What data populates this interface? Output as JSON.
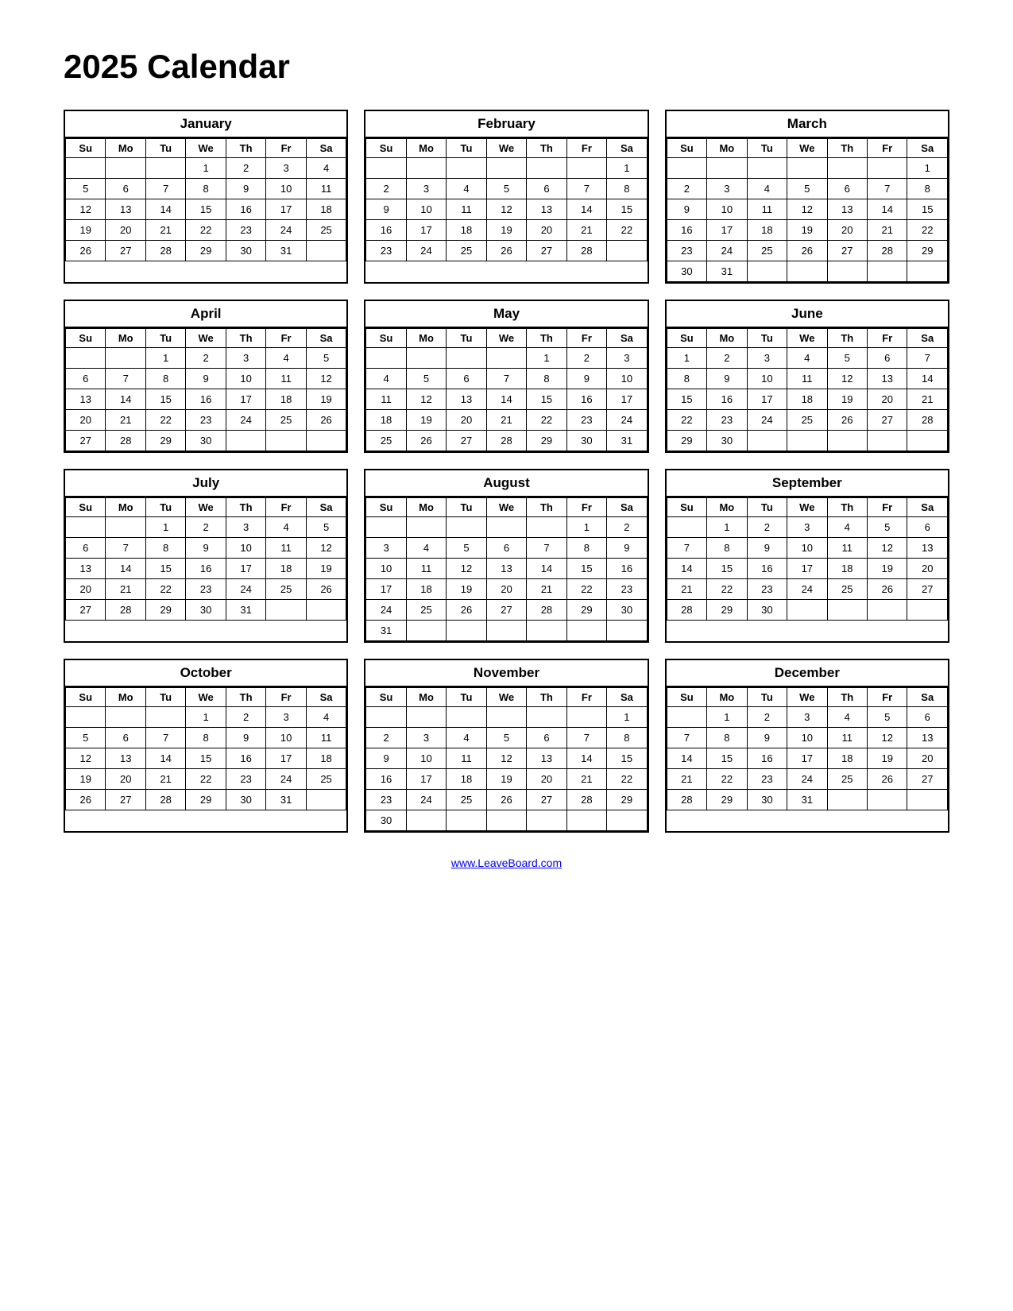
{
  "title": "2025 Calendar",
  "footer": "www.LeaveBoard.com",
  "days_header": [
    "Su",
    "Mo",
    "Tu",
    "We",
    "Th",
    "Fr",
    "Sa"
  ],
  "months": [
    {
      "name": "January",
      "weeks": [
        [
          "",
          "",
          "",
          "1",
          "2",
          "3",
          "4"
        ],
        [
          "5",
          "6",
          "7",
          "8",
          "9",
          "10",
          "11"
        ],
        [
          "12",
          "13",
          "14",
          "15",
          "16",
          "17",
          "18"
        ],
        [
          "19",
          "20",
          "21",
          "22",
          "23",
          "24",
          "25"
        ],
        [
          "26",
          "27",
          "28",
          "29",
          "30",
          "31",
          ""
        ]
      ]
    },
    {
      "name": "February",
      "weeks": [
        [
          "",
          "",
          "",
          "",
          "",
          "",
          "1"
        ],
        [
          "2",
          "3",
          "4",
          "5",
          "6",
          "7",
          "8"
        ],
        [
          "9",
          "10",
          "11",
          "12",
          "13",
          "14",
          "15"
        ],
        [
          "16",
          "17",
          "18",
          "19",
          "20",
          "21",
          "22"
        ],
        [
          "23",
          "24",
          "25",
          "26",
          "27",
          "28",
          ""
        ]
      ]
    },
    {
      "name": "March",
      "weeks": [
        [
          "",
          "",
          "",
          "",
          "",
          "",
          "1"
        ],
        [
          "2",
          "3",
          "4",
          "5",
          "6",
          "7",
          "8"
        ],
        [
          "9",
          "10",
          "11",
          "12",
          "13",
          "14",
          "15"
        ],
        [
          "16",
          "17",
          "18",
          "19",
          "20",
          "21",
          "22"
        ],
        [
          "23",
          "24",
          "25",
          "26",
          "27",
          "28",
          "29"
        ],
        [
          "30",
          "31",
          "",
          "",
          "",
          "",
          ""
        ]
      ]
    },
    {
      "name": "April",
      "weeks": [
        [
          "",
          "",
          "1",
          "2",
          "3",
          "4",
          "5"
        ],
        [
          "6",
          "7",
          "8",
          "9",
          "10",
          "11",
          "12"
        ],
        [
          "13",
          "14",
          "15",
          "16",
          "17",
          "18",
          "19"
        ],
        [
          "20",
          "21",
          "22",
          "23",
          "24",
          "25",
          "26"
        ],
        [
          "27",
          "28",
          "29",
          "30",
          "",
          "",
          ""
        ]
      ]
    },
    {
      "name": "May",
      "weeks": [
        [
          "",
          "",
          "",
          "",
          "1",
          "2",
          "3"
        ],
        [
          "4",
          "5",
          "6",
          "7",
          "8",
          "9",
          "10"
        ],
        [
          "11",
          "12",
          "13",
          "14",
          "15",
          "16",
          "17"
        ],
        [
          "18",
          "19",
          "20",
          "21",
          "22",
          "23",
          "24"
        ],
        [
          "25",
          "26",
          "27",
          "28",
          "29",
          "30",
          "31"
        ]
      ]
    },
    {
      "name": "June",
      "weeks": [
        [
          "1",
          "2",
          "3",
          "4",
          "5",
          "6",
          "7"
        ],
        [
          "8",
          "9",
          "10",
          "11",
          "12",
          "13",
          "14"
        ],
        [
          "15",
          "16",
          "17",
          "18",
          "19",
          "20",
          "21"
        ],
        [
          "22",
          "23",
          "24",
          "25",
          "26",
          "27",
          "28"
        ],
        [
          "29",
          "30",
          "",
          "",
          "",
          "",
          ""
        ]
      ]
    },
    {
      "name": "July",
      "weeks": [
        [
          "",
          "",
          "1",
          "2",
          "3",
          "4",
          "5"
        ],
        [
          "6",
          "7",
          "8",
          "9",
          "10",
          "11",
          "12"
        ],
        [
          "13",
          "14",
          "15",
          "16",
          "17",
          "18",
          "19"
        ],
        [
          "20",
          "21",
          "22",
          "23",
          "24",
          "25",
          "26"
        ],
        [
          "27",
          "28",
          "29",
          "30",
          "31",
          "",
          ""
        ]
      ]
    },
    {
      "name": "August",
      "weeks": [
        [
          "",
          "",
          "",
          "",
          "",
          "1",
          "2"
        ],
        [
          "3",
          "4",
          "5",
          "6",
          "7",
          "8",
          "9"
        ],
        [
          "10",
          "11",
          "12",
          "13",
          "14",
          "15",
          "16"
        ],
        [
          "17",
          "18",
          "19",
          "20",
          "21",
          "22",
          "23"
        ],
        [
          "24",
          "25",
          "26",
          "27",
          "28",
          "29",
          "30"
        ],
        [
          "31",
          "",
          "",
          "",
          "",
          "",
          ""
        ]
      ]
    },
    {
      "name": "September",
      "weeks": [
        [
          "",
          "1",
          "2",
          "3",
          "4",
          "5",
          "6"
        ],
        [
          "7",
          "8",
          "9",
          "10",
          "11",
          "12",
          "13"
        ],
        [
          "14",
          "15",
          "16",
          "17",
          "18",
          "19",
          "20"
        ],
        [
          "21",
          "22",
          "23",
          "24",
          "25",
          "26",
          "27"
        ],
        [
          "28",
          "29",
          "30",
          "",
          "",
          "",
          ""
        ]
      ]
    },
    {
      "name": "October",
      "weeks": [
        [
          "",
          "",
          "",
          "1",
          "2",
          "3",
          "4"
        ],
        [
          "5",
          "6",
          "7",
          "8",
          "9",
          "10",
          "11"
        ],
        [
          "12",
          "13",
          "14",
          "15",
          "16",
          "17",
          "18"
        ],
        [
          "19",
          "20",
          "21",
          "22",
          "23",
          "24",
          "25"
        ],
        [
          "26",
          "27",
          "28",
          "29",
          "30",
          "31",
          ""
        ]
      ]
    },
    {
      "name": "November",
      "weeks": [
        [
          "",
          "",
          "",
          "",
          "",
          "",
          "1"
        ],
        [
          "2",
          "3",
          "4",
          "5",
          "6",
          "7",
          "8"
        ],
        [
          "9",
          "10",
          "11",
          "12",
          "13",
          "14",
          "15"
        ],
        [
          "16",
          "17",
          "18",
          "19",
          "20",
          "21",
          "22"
        ],
        [
          "23",
          "24",
          "25",
          "26",
          "27",
          "28",
          "29"
        ],
        [
          "30",
          "",
          "",
          "",
          "",
          "",
          ""
        ]
      ]
    },
    {
      "name": "December",
      "weeks": [
        [
          "",
          "1",
          "2",
          "3",
          "4",
          "5",
          "6"
        ],
        [
          "7",
          "8",
          "9",
          "10",
          "11",
          "12",
          "13"
        ],
        [
          "14",
          "15",
          "16",
          "17",
          "18",
          "19",
          "20"
        ],
        [
          "21",
          "22",
          "23",
          "24",
          "25",
          "26",
          "27"
        ],
        [
          "28",
          "29",
          "30",
          "31",
          "",
          "",
          ""
        ]
      ]
    }
  ]
}
